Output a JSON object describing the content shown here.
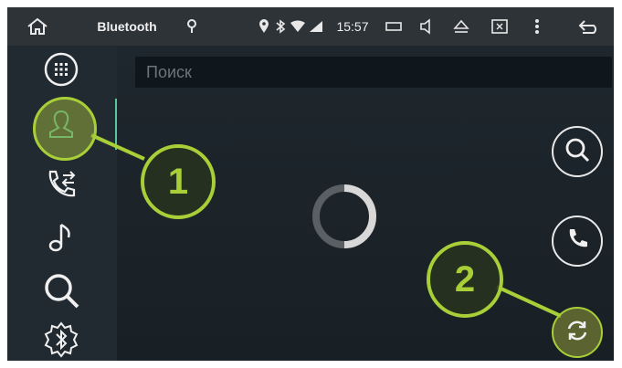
{
  "status_bar": {
    "title": "Bluetooth",
    "time": "15:57",
    "icons": [
      "home-icon",
      "bluetooth-pin-icon",
      "location-icon",
      "bluetooth-icon",
      "wifi-icon",
      "signal-icon",
      "screen-icon",
      "volume-icon",
      "eject-icon",
      "close-window-icon",
      "more-vert-icon",
      "back-icon"
    ]
  },
  "sidebar": {
    "items": [
      {
        "icon": "dialpad-icon"
      },
      {
        "icon": "contacts-icon",
        "active": true
      },
      {
        "icon": "call-log-icon"
      },
      {
        "icon": "music-icon"
      },
      {
        "icon": "search-icon"
      },
      {
        "icon": "bluetooth-settings-icon"
      }
    ]
  },
  "search": {
    "placeholder": "Поиск"
  },
  "actions": [
    "search-icon",
    "phone-icon",
    "refresh-icon"
  ],
  "annotations": [
    {
      "label": "1"
    },
    {
      "label": "2"
    }
  ],
  "colors": {
    "accent_line": "#58c79b",
    "annotation": "#a8cf38",
    "background": "#1c242b"
  }
}
